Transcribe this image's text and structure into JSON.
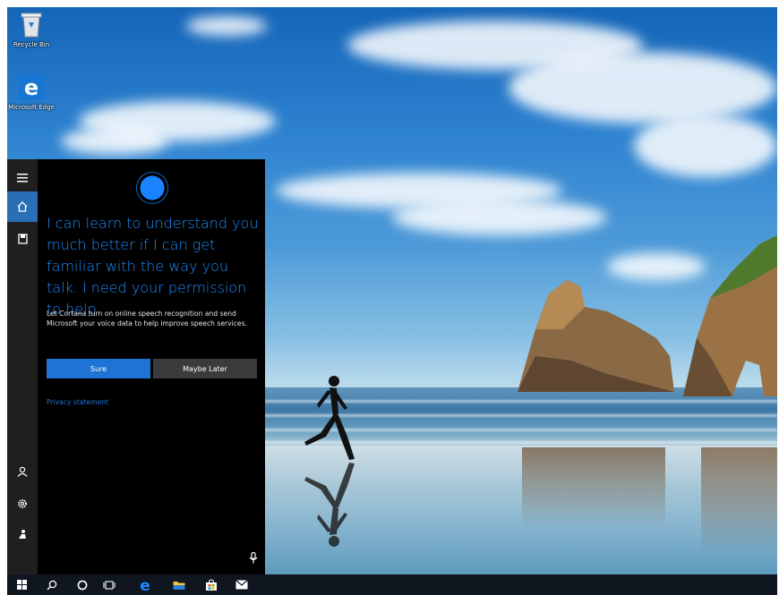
{
  "desktop": {
    "icons": [
      {
        "label": "Recycle Bin",
        "icon": "recycle-bin-icon"
      },
      {
        "label": "Microsoft Edge",
        "icon": "edge-icon"
      }
    ]
  },
  "cortana": {
    "rail": {
      "top": [
        "hamburger-menu-icon",
        "home-icon",
        "notebook-icon"
      ],
      "bottom": [
        "user-icon",
        "settings-gear-icon",
        "feedback-icon"
      ],
      "active": "home-icon"
    },
    "headline": "I can learn to understand you much better if I can get familiar with the way you talk. I need your permission to help.",
    "body": "Let Cortana turn on online speech recognition and send Microsoft your voice data to help improve speech services.",
    "buttons": {
      "sure": "Sure",
      "later": "Maybe Later"
    },
    "privacy_link": "Privacy statement",
    "mic_icon": "microphone-icon"
  },
  "taskbar": {
    "items": [
      "start-icon",
      "search-icon",
      "cortana-circle-icon",
      "task-view-icon",
      "edge-icon",
      "file-explorer-icon",
      "store-icon",
      "mail-icon"
    ]
  },
  "colors": {
    "accent": "#1e73d4",
    "headline": "#1e8dff",
    "panel": "#000000",
    "rail": "#1f1f1f",
    "taskbar": "#0f1620"
  }
}
